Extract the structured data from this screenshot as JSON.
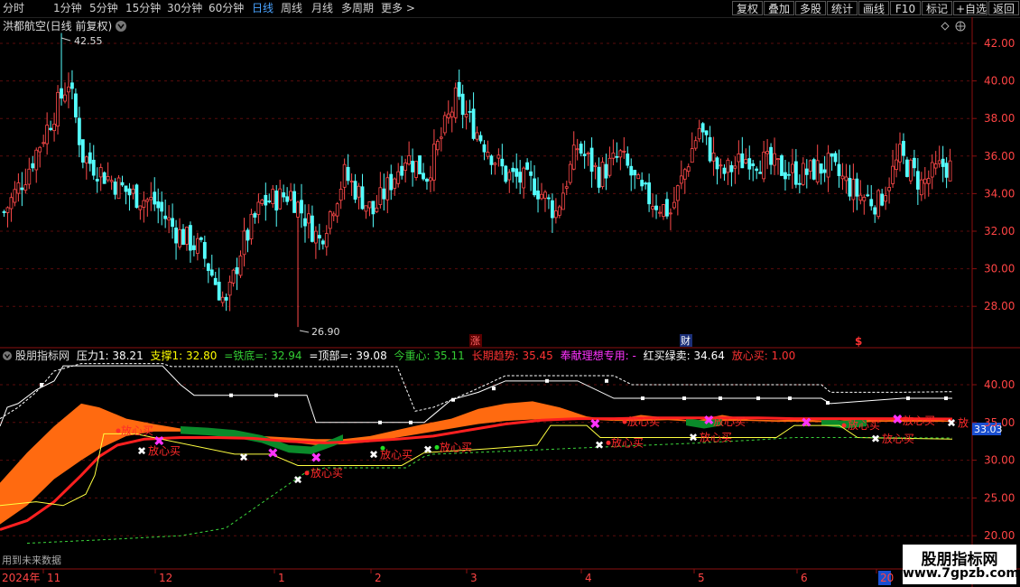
{
  "toolbar": {
    "periods": [
      "分时",
      "1分钟",
      "5分钟",
      "15分钟",
      "30分钟",
      "60分钟",
      "日线",
      "周线",
      "月线",
      "多周期",
      "更多 >"
    ],
    "active_period": "日线",
    "right_buttons": [
      "复权",
      "叠加",
      "多股",
      "统计",
      "画线",
      "F10",
      "标记",
      "+自选",
      "返回"
    ]
  },
  "main_panel": {
    "title": "洪都航空(日线 前复权)",
    "max_label": "42.55",
    "min_label": "26.90",
    "markers": [
      {
        "text": "涨",
        "color": "#ff5555",
        "bg": "#5a0000"
      },
      {
        "text": "财",
        "color": "#ffffff",
        "bg": "#1b2f78"
      },
      {
        "text": "$",
        "color": "#ff3333",
        "bg": ""
      }
    ],
    "y_ticks": [
      "42.00",
      "40.00",
      "38.00",
      "36.00",
      "34.00",
      "32.00",
      "30.00",
      "28.00"
    ]
  },
  "indicator_panel": {
    "title": "股朋指标网",
    "items": [
      {
        "label": "压力1: ",
        "value": "38.21",
        "color": "#ffffff"
      },
      {
        "label": "支撑1: ",
        "value": "32.80",
        "color": "#ffff00"
      },
      {
        "label": "=铁底=: ",
        "value": "32.94",
        "color": "#33cc33"
      },
      {
        "label": "=顶部=: ",
        "value": "39.08",
        "color": "#ffffff"
      },
      {
        "label": "今重心: ",
        "value": "35.11",
        "color": "#33cc33"
      },
      {
        "label": "长期趋势: ",
        "value": "35.45",
        "color": "#ff3333"
      },
      {
        "label": "奉献理想专用: ",
        "value": "-",
        "color": "#ff33ff"
      },
      {
        "label": "红买绿卖: ",
        "value": "34.64",
        "color": "#ffffff"
      },
      {
        "label": "放心买: ",
        "value": "1.00",
        "color": "#ff3333"
      }
    ],
    "current_value": "33.03",
    "y_ticks": [
      "40.00",
      "35.00",
      "30.00",
      "25.00",
      "20.00"
    ],
    "signal_text": "放心买",
    "signal_text_truncated": "放",
    "future_data_note": "用到未来数据"
  },
  "x_axis": {
    "year_label": "2024年",
    "months": [
      "11",
      "12",
      "1",
      "2",
      "3",
      "4",
      "5",
      "6",
      "20"
    ]
  },
  "watermark": {
    "line1": "股朋指标网",
    "line2": "www.7gpzb.com"
  },
  "chart_data": {
    "type": "candlestick",
    "symbol": "洪都航空",
    "period": "日线",
    "adjustment": "前复权",
    "price_ylim": [
      26.0,
      43.5
    ],
    "price_max": 42.55,
    "price_min": 26.9,
    "approx_closes_by_segment": [
      {
        "period": "2024-10 to 11",
        "range": [
          31.5,
          42.55
        ]
      },
      {
        "period": "2024-12",
        "range": [
          31,
          36
        ]
      },
      {
        "period": "2025-01",
        "range": [
          26.9,
          33.5
        ]
      },
      {
        "period": "2025-02",
        "range": [
          31,
          36
        ]
      },
      {
        "period": "2025-03",
        "range": [
          33,
          40.8
        ]
      },
      {
        "period": "2025-04",
        "range": [
          32.5,
          37.5
        ]
      },
      {
        "period": "2025-05",
        "range": [
          32.5,
          40
        ]
      },
      {
        "period": "2025-06",
        "range": [
          33,
          38
        ]
      }
    ],
    "indicator_ylim": [
      18.0,
      45.0
    ],
    "indicator_series": [
      {
        "name": "压力1",
        "last": 38.21
      },
      {
        "name": "支撑1",
        "last": 32.8
      },
      {
        "name": "=铁底=",
        "last": 32.94
      },
      {
        "name": "=顶部=",
        "last": 39.08
      },
      {
        "name": "今重心",
        "last": 35.11
      },
      {
        "name": "长期趋势",
        "last": 35.45
      },
      {
        "name": "红买绿卖",
        "last": 34.64
      },
      {
        "name": "放心买",
        "last": 1.0
      }
    ]
  }
}
